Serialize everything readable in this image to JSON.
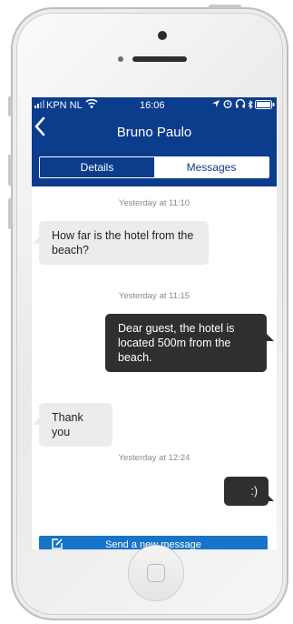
{
  "status_bar": {
    "carrier": "KPN NL",
    "time": "16:06",
    "icons": [
      "signal-icon",
      "wifi-icon",
      "location-icon",
      "alarm-icon",
      "headphones-icon",
      "battery-icon"
    ]
  },
  "header": {
    "title": "Bruno Paulo",
    "back_icon": "chevron-left-icon"
  },
  "tabs": [
    {
      "label": "Details",
      "selected": false
    },
    {
      "label": "Messages",
      "selected": true
    }
  ],
  "messages": [
    {
      "timestamp": "Yesterday at 11:10",
      "direction": "incoming",
      "text": "How far is the hotel from the beach?"
    },
    {
      "timestamp": "Yesterday at 11:15",
      "direction": "outgoing",
      "text": "Dear guest, the hotel is located 500m from the beach."
    },
    {
      "timestamp": "",
      "direction": "incoming",
      "text": "Thank you"
    },
    {
      "timestamp": "Yesterday at 12:24",
      "direction": "outgoing",
      "text": ":)"
    }
  ],
  "composer": {
    "label": "Send a new message",
    "icon": "compose-icon"
  },
  "colors": {
    "nav_bar": "#0c3c8c",
    "incoming_bubble": "#ececec",
    "outgoing_bubble": "#2f2f2f",
    "send_button": "#1874c8"
  }
}
